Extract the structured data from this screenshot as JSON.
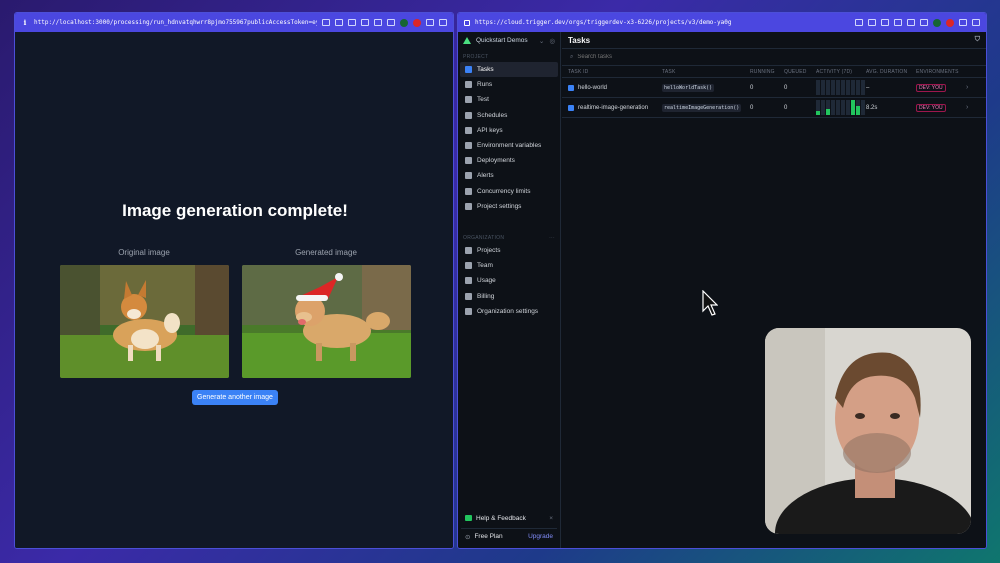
{
  "left_window": {
    "url": "http://localhost:3000/processing/run_hdnvatqhwrr8pjmo755967publicAccessToken=eyJhbGciOiJIUzI1N…",
    "headline": "Image generation complete!",
    "original_label": "Original image",
    "generated_label": "Generated image",
    "button_label": "Generate another image"
  },
  "right_window": {
    "url": "https://cloud.trigger.dev/orgs/triggerdev-x3-6226/projects/v3/demo-ya0g",
    "sidebar": {
      "org_name": "Quickstart Demos",
      "project_section": "PROJECT",
      "project_items": [
        {
          "label": "Tasks",
          "icon": "tasks-icon"
        },
        {
          "label": "Runs",
          "icon": "runs-icon"
        },
        {
          "label": "Test",
          "icon": "test-icon"
        },
        {
          "label": "Schedules",
          "icon": "schedules-icon"
        },
        {
          "label": "API keys",
          "icon": "key-icon"
        },
        {
          "label": "Environment variables",
          "icon": "env-vars-icon"
        },
        {
          "label": "Deployments",
          "icon": "deployments-icon"
        },
        {
          "label": "Alerts",
          "icon": "alerts-icon"
        },
        {
          "label": "Concurrency limits",
          "icon": "concurrency-icon"
        },
        {
          "label": "Project settings",
          "icon": "settings-icon"
        }
      ],
      "org_section": "ORGANIZATION",
      "org_items": [
        {
          "label": "Projects",
          "icon": "folder-icon"
        },
        {
          "label": "Team",
          "icon": "team-icon"
        },
        {
          "label": "Usage",
          "icon": "usage-icon"
        },
        {
          "label": "Billing",
          "icon": "billing-icon"
        },
        {
          "label": "Organization settings",
          "icon": "settings-icon"
        }
      ],
      "help_label": "Help & Feedback",
      "plan_label": "Free Plan",
      "upgrade_label": "Upgrade"
    },
    "main": {
      "title": "Tasks",
      "search_placeholder": "Search tasks",
      "columns": [
        "TASK ID",
        "TASK",
        "RUNNING",
        "QUEUED",
        "ACTIVITY (7D)",
        "AVG. DURATION",
        "ENVIRONMENTS"
      ],
      "rows": [
        {
          "task_id": "hello-world",
          "task": "helloWorldTask()",
          "running": "0",
          "queued": "0",
          "activity": [
            0,
            0,
            0,
            0,
            0,
            0,
            0,
            0,
            0,
            0
          ],
          "avg_duration": "–",
          "env": "DEV: YOU"
        },
        {
          "task_id": "realtime-image-generation",
          "task": "realtimeImageGeneration()",
          "running": "0",
          "queued": "0",
          "activity": [
            0.3,
            0,
            0.4,
            0,
            0,
            0,
            0,
            1,
            0.6,
            0
          ],
          "avg_duration": "8.2s",
          "env": "DEV: YOU"
        }
      ]
    }
  },
  "colors": {
    "accent": "#4b47e0",
    "button": "#3b82f6",
    "success": "#22c55e",
    "env_badge": "#f472b6"
  }
}
